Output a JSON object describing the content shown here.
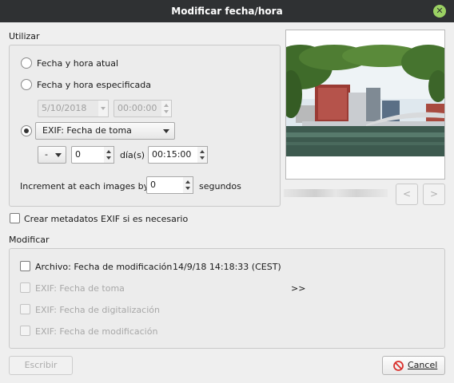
{
  "window": {
    "title": "Modificar fecha/hora"
  },
  "use_group": {
    "label": "Utilizar",
    "radio_current": "Fecha y hora atual",
    "radio_specified": "Fecha y hora especificada",
    "specified_date": "5/10/2018",
    "specified_time": "00:00:00",
    "exif_source_selected": "EXIF: Fecha de toma",
    "offset_sign": "-",
    "offset_days": "0",
    "days_label": "día(s)",
    "offset_time": "00:15:00",
    "increment_label": "Increment at each images by",
    "increment_value": "0",
    "seconds_label": "segundos"
  },
  "create_exif_label": "Crear metadatos EXIF si es necesario",
  "modify_group": {
    "label": "Modificar",
    "file_mod_label": "Archivo: Fecha de modificación",
    "file_mod_value": "14/9/18 14:18:33 (CEST)",
    "exif_taken_label": "EXIF: Fecha de toma",
    "arrows": ">>",
    "exif_digitized_label": "EXIF: Fecha de digitalización",
    "exif_modified_label": "EXIF: Fecha de modificación"
  },
  "preview": {
    "prev": "<",
    "next": ">"
  },
  "buttons": {
    "write": "Escribir",
    "cancel": "Cancel"
  },
  "colors": {
    "titlebar": "#2f3133",
    "close": "#9bd163",
    "cancel_icon": "#d9302c"
  }
}
